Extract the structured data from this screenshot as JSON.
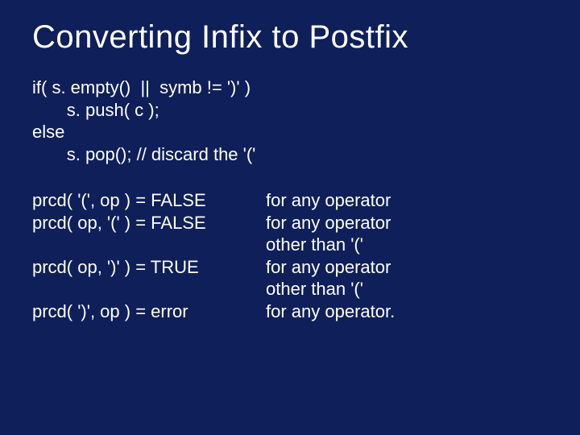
{
  "title": "Converting Infix to Postfix",
  "code": {
    "line1": "if( s. empty()  ||  symb != ')' )",
    "line2": "       s. push( c );",
    "line3": "else",
    "line4": "       s. pop(); // discard the '('"
  },
  "rules": {
    "r1_left": "prcd( '(', op ) = FALSE",
    "r1_right": "for any operator",
    "r2_left": "prcd( op, '(' ) = FALSE",
    "r2_right": "for any operator",
    "r2b_left": "",
    "r2b_right": "other than '('",
    "r3_left": "prcd( op, ')' ) = TRUE",
    "r3_right": "for any operator",
    "r3b_left": "",
    "r3b_right": "other than '('",
    "r4_left": "prcd( ')', op ) = error",
    "r4_right": "for any operator."
  }
}
